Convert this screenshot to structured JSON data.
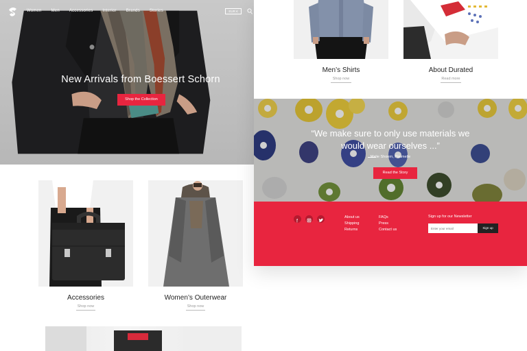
{
  "left": {
    "nav": {
      "logo": "brand-logo",
      "links": [
        "Women",
        "Men",
        "Accessories",
        "Interior",
        "Brands",
        "Stories"
      ],
      "currency": "EUR €"
    },
    "hero": {
      "title": "New Arrivals from Boessert Schorn",
      "button": "Shop the Collection"
    },
    "products": [
      {
        "name": "Accessories",
        "link": "Shop now"
      },
      {
        "name": "Women’s Outerwear",
        "link": "Shop now"
      }
    ]
  },
  "right": {
    "cards": [
      {
        "name": "Men’s Shirts",
        "link": "Shop now"
      },
      {
        "name": "About Durated",
        "link": "Read more"
      }
    ],
    "quote": {
      "text": "“We make sure to only use materials we would wear ourselves ...”",
      "author": "Malie Shoern, Paumelle",
      "button": "Read the Story"
    },
    "footer": {
      "col1": [
        "About us",
        "Shipping",
        "Returns"
      ],
      "col2": [
        "FAQs",
        "Press",
        "Contact us"
      ],
      "newsletter_title": "Sign up for our Newsletter",
      "email_placeholder": "Enter your email",
      "signup_label": "Sign up"
    }
  },
  "colors": {
    "accent": "#e8253f",
    "dark": "#222222"
  }
}
